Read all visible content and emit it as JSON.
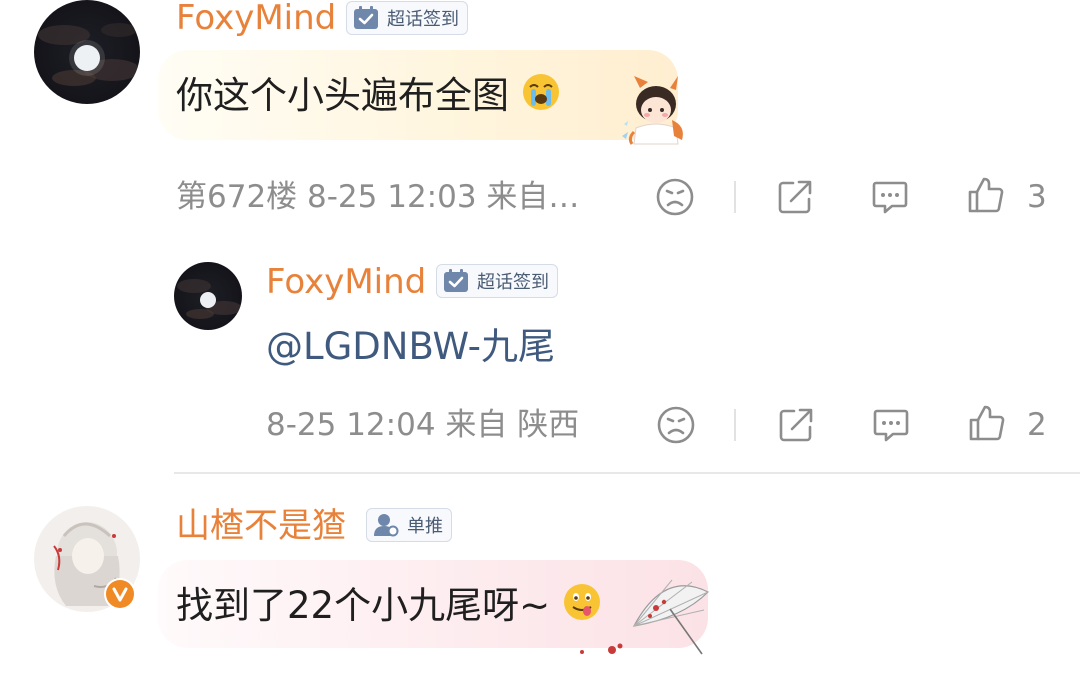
{
  "comments": [
    {
      "username": "FoxyMind",
      "badge": "超话签到",
      "text": "你这个小头遍布全图",
      "meta": "第672楼 8-25 12:03 来自…",
      "like_count": "3",
      "avatar": "moon-night-avatar",
      "sticker": "fox-chibi-sticker"
    },
    {
      "username": "FoxyMind",
      "badge": "超话签到",
      "text": "@LGDNBW-九尾",
      "meta": "8-25 12:04 来自 陕西",
      "like_count": "2",
      "avatar": "moon-night-avatar"
    },
    {
      "username": "山楂不是猹",
      "badge": "单推",
      "text": "找到了22个小九尾呀~",
      "avatar": "anime-girl-avatar",
      "verified": "V",
      "sticker": "umbrella-sticker"
    }
  ],
  "icons": {
    "dislike": "sad-face-icon",
    "share": "share-icon",
    "comment": "comment-icon",
    "like": "thumbs-up-icon"
  },
  "colors": {
    "username": "#e8823a",
    "badge_text": "#4a5b74",
    "mention": "#3f5a7e",
    "meta": "#8d8d8d",
    "verified": "#f08a24"
  }
}
